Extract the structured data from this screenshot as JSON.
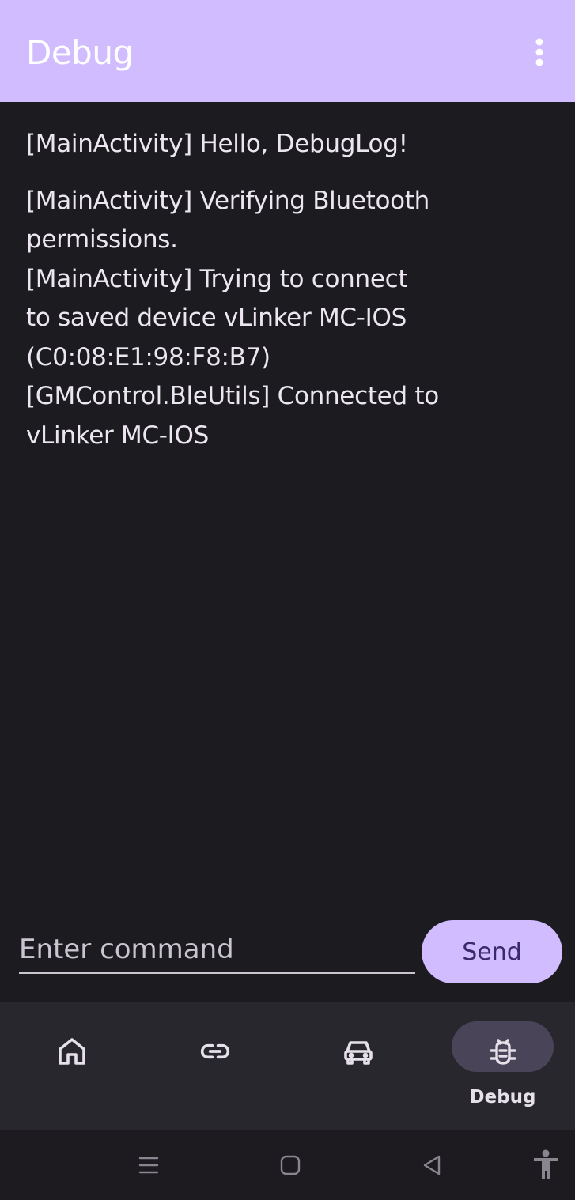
{
  "app_bar": {
    "title": "Debug",
    "menu_icon": "more-vertical-icon",
    "background": "#d0bcfe"
  },
  "log": {
    "entries": [
      "[MainActivity] Hello, DebugLog!",
      "[MainActivity] Verifying Bluetooth\npermissions.\n[MainActivity] Trying to connect\nto saved device vLinker MC-IOS\n(C0:08:E1:98:F8:B7)\n[GMControl.BleUtils] Connected to\nvLinker MC-IOS"
    ]
  },
  "command": {
    "placeholder": "Enter command",
    "value": "",
    "send_label": "Send"
  },
  "bottom_nav": {
    "items": [
      {
        "icon": "home-icon",
        "label": "",
        "selected": false
      },
      {
        "icon": "link-icon",
        "label": "",
        "selected": false
      },
      {
        "icon": "car-icon",
        "label": "",
        "selected": false
      },
      {
        "icon": "bug-icon",
        "label": "Debug",
        "selected": true
      }
    ]
  },
  "system_nav": {
    "icons": [
      "recent-apps-icon",
      "home-button-icon",
      "back-icon",
      "accessibility-icon"
    ]
  },
  "colors": {
    "accent": "#d0bcfe",
    "background": "#1c1b20",
    "nav_background": "#29272e",
    "selected_pill": "#4a4458"
  }
}
